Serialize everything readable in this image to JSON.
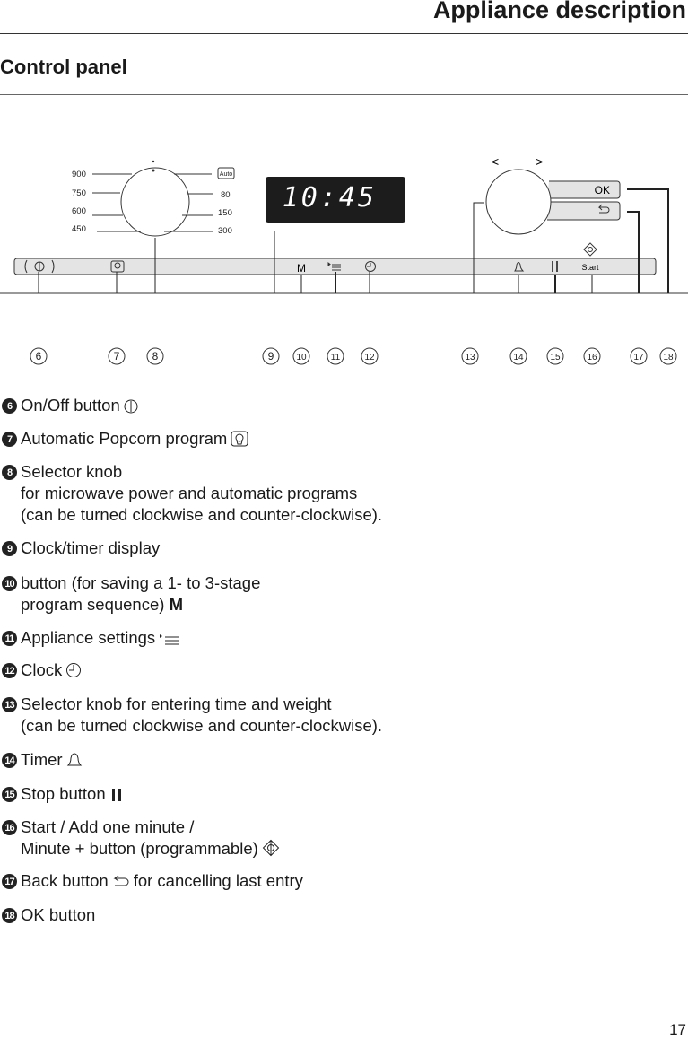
{
  "header": {
    "title": "Appliance description",
    "section": "Control panel"
  },
  "panel": {
    "power_left": [
      "900",
      "750",
      "600",
      "450"
    ],
    "power_right": [
      "Auto",
      "80",
      "150",
      "300"
    ],
    "display_time": "10:45",
    "arrows": [
      "<",
      ">"
    ],
    "ok_label": "OK",
    "menu_label": "M",
    "start_label": "Start",
    "callouts": [
      "6",
      "7",
      "8",
      "9",
      "10",
      "11",
      "12",
      "13",
      "14",
      "15",
      "16",
      "17",
      "18"
    ]
  },
  "items": [
    {
      "num": "6",
      "lines": [
        "On/Off button"
      ],
      "icon": "power-icon"
    },
    {
      "num": "7",
      "lines": [
        "Automatic Popcorn program"
      ],
      "icon": "popcorn-icon"
    },
    {
      "num": "8",
      "lines": [
        "Selector knob",
        "for microwave power and automatic programs",
        "(can be turned clockwise and counter-clockwise)."
      ]
    },
    {
      "num": "9",
      "lines": [
        "Clock/timer display"
      ]
    },
    {
      "num": "10",
      "lines": [
        "button (for saving a 1- to 3-stage",
        "program sequence)"
      ],
      "suffix": "M"
    },
    {
      "num": "11",
      "lines": [
        "Appliance settings"
      ],
      "icon": "settings-icon"
    },
    {
      "num": "12",
      "lines": [
        "Clock"
      ],
      "icon": "clock-icon"
    },
    {
      "num": "13",
      "lines": [
        "Selector knob for entering time and weight",
        "(can be turned clockwise and counter-clockwise)."
      ]
    },
    {
      "num": "14",
      "lines": [
        "Timer"
      ],
      "icon": "bell-icon"
    },
    {
      "num": "15",
      "lines": [
        "Stop button"
      ],
      "icon": "pause-icon"
    },
    {
      "num": "16",
      "lines": [
        "Start / Add one minute /",
        "Minute + button (programmable)"
      ],
      "icon": "start-icon"
    },
    {
      "num": "17",
      "lines": [
        "Back button",
        "for cancelling last entry"
      ],
      "icon": "back-icon"
    },
    {
      "num": "18",
      "lines": [
        "OK button"
      ]
    }
  ],
  "page_number": "17"
}
